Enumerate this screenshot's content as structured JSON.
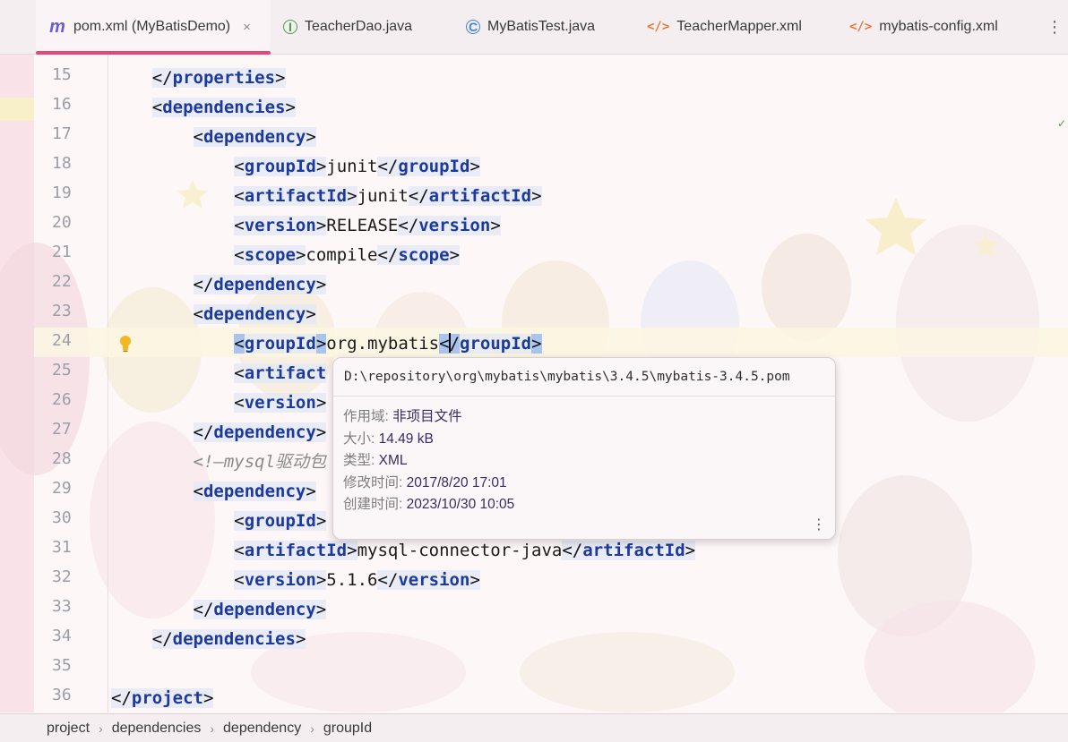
{
  "tabs": [
    {
      "label": "pom.xml (MyBatisDemo)",
      "icon": "maven-m-icon",
      "active": true
    },
    {
      "label": "TeacherDao.java",
      "icon": "interface-icon"
    },
    {
      "label": "MyBatisTest.java",
      "icon": "class-icon"
    },
    {
      "label": "TeacherMapper.xml",
      "icon": "xml-file-icon"
    },
    {
      "label": "mybatis-config.xml",
      "icon": "xml-file-icon"
    }
  ],
  "tab_icon_glyphs": {
    "maven": "m",
    "interface": "I",
    "class": "C",
    "xml": "</>",
    "close": "×",
    "more": "⋮"
  },
  "accent_color": "#e2477d",
  "editor": {
    "lines": [
      {
        "n": "15",
        "text": "    </properties>"
      },
      {
        "n": "16",
        "text": "    <dependencies>"
      },
      {
        "n": "17",
        "text": "        <dependency>"
      },
      {
        "n": "18",
        "text": "            <groupId>junit</groupId>"
      },
      {
        "n": "19",
        "text": "            <artifactId>junit</artifactId>"
      },
      {
        "n": "20",
        "text": "            <version>RELEASE</version>"
      },
      {
        "n": "21",
        "text": "            <scope>compile</scope>"
      },
      {
        "n": "22",
        "text": "        </dependency>"
      },
      {
        "n": "23",
        "text": "        <dependency>"
      },
      {
        "n": "24",
        "text": "            <groupId>org.mybatis</groupId>"
      },
      {
        "n": "25",
        "text": "            <artifact"
      },
      {
        "n": "26",
        "text": "            <version>"
      },
      {
        "n": "27",
        "text": "        </dependency>"
      },
      {
        "n": "28",
        "text": "        <!—mysql驱动包"
      },
      {
        "n": "29",
        "text": "        <dependency>"
      },
      {
        "n": "30",
        "text": "            <groupId>"
      },
      {
        "n": "31",
        "text": "            <artifactId>mysql-connector-java</artifactId>"
      },
      {
        "n": "32",
        "text": "            <version>5.1.6</version>"
      },
      {
        "n": "33",
        "text": "        </dependency>"
      },
      {
        "n": "34",
        "text": "    </dependencies>"
      },
      {
        "n": "35",
        "text": ""
      },
      {
        "n": "36",
        "text": "</project>"
      }
    ],
    "current_line": "24"
  },
  "popup": {
    "path": "D:\\repository\\org\\mybatis\\mybatis\\3.4.5\\mybatis-3.4.5.pom",
    "rows": [
      {
        "key": "作用域: ",
        "value": "非项目文件"
      },
      {
        "key": "大小: ",
        "value": "14.49 kB"
      },
      {
        "key": "类型: ",
        "value": "XML"
      },
      {
        "key": "修改时间: ",
        "value": "2017/8/20 17:01"
      },
      {
        "key": "创建时间: ",
        "value": "2023/10/30 10:05"
      }
    ]
  },
  "breadcrumb": [
    "project",
    "dependencies",
    "dependency",
    "groupId"
  ]
}
